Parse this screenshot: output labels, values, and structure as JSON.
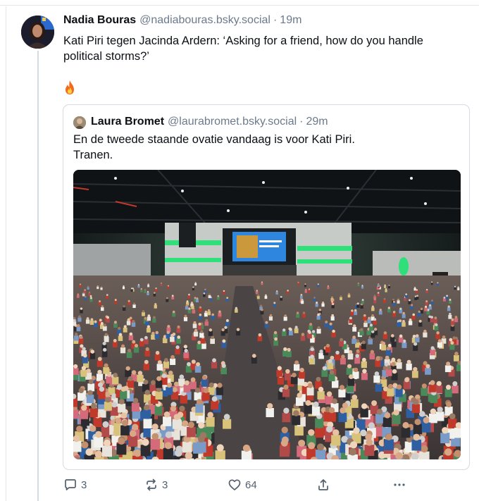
{
  "post": {
    "author_name": "Nadia Bouras",
    "author_handle": "@nadiabouras.bsky.social",
    "separator": "·",
    "time": "19m",
    "text": "Kati Piri tegen Jacinda Ardern: ‘Asking for a friend, how do you handle political storms?’",
    "emoji": "🔥"
  },
  "quote": {
    "author_name": "Laura Bromet",
    "author_handle": "@laurabromet.bsky.social",
    "separator": "·",
    "time": "29m",
    "text_line1": "En de tweede staande ovatie vandaag is voor Kati Piri.",
    "text_line2": "Tranen.",
    "image_icon": "photo-conference-hall-crowd"
  },
  "actions": {
    "reply_count": "3",
    "repost_count": "3",
    "like_count": "64",
    "reply_icon": "reply-icon",
    "repost_icon": "repost-icon",
    "like_icon": "heart-icon",
    "share_icon": "share-icon",
    "more_icon": "more-icon"
  },
  "colors": {
    "text_primary": "#0b0f14",
    "text_secondary": "#6b7a8c",
    "border": "#d4dbe2",
    "stage_green": "#2fe07a"
  }
}
